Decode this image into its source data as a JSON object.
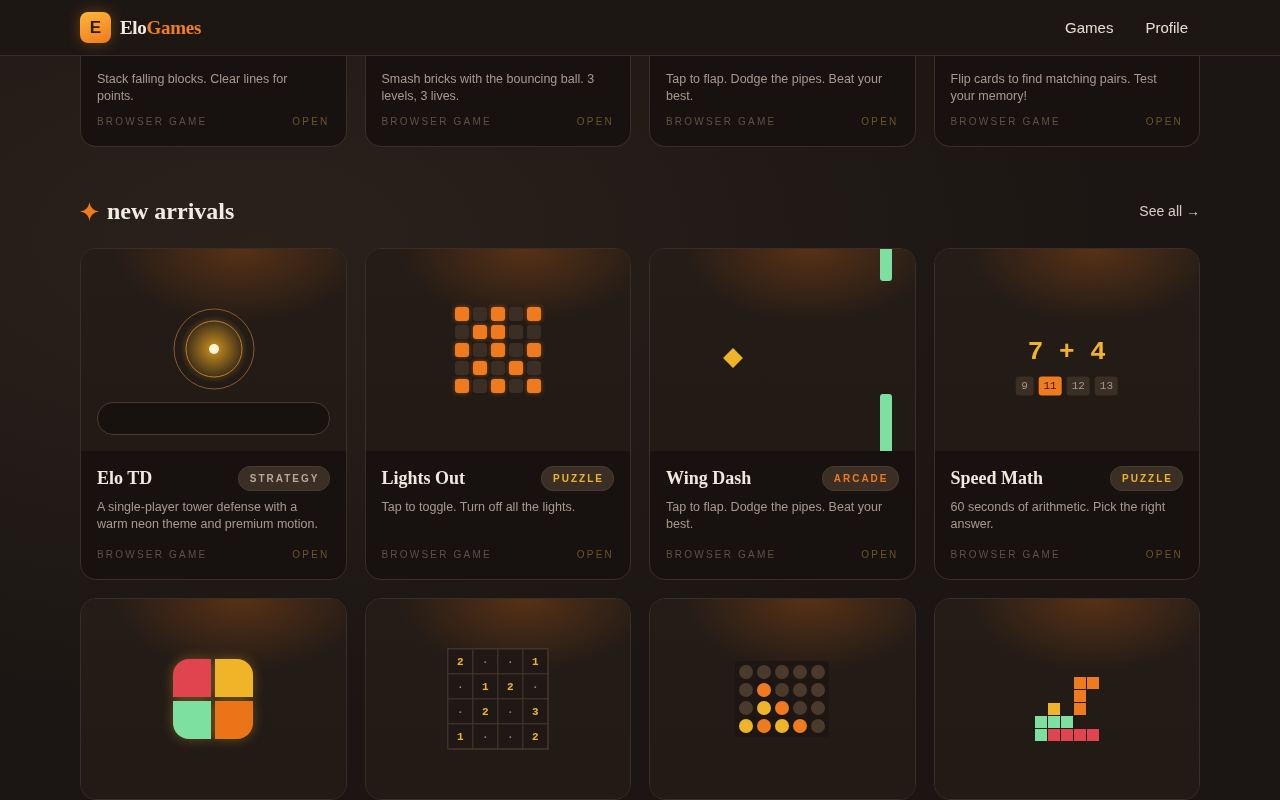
{
  "header": {
    "brand": {
      "mark": "E",
      "first": "Elo",
      "second": "Games"
    },
    "nav": [
      {
        "label": "Games"
      },
      {
        "label": "Profile"
      }
    ]
  },
  "top_row": [
    {
      "description": "Stack falling blocks. Clear lines for points.",
      "platform": "BROWSER GAME",
      "action": "OPEN"
    },
    {
      "description": "Smash bricks with the bouncing ball. 3 levels, 3 lives.",
      "platform": "BROWSER GAME",
      "action": "OPEN"
    },
    {
      "description": "Tap to flap. Dodge the pipes. Beat your best.",
      "platform": "BROWSER GAME",
      "action": "OPEN"
    },
    {
      "description": "Flip cards to find matching pairs. Test your memory!",
      "platform": "BROWSER GAME",
      "action": "OPEN"
    }
  ],
  "section": {
    "title": "new arrivals",
    "link": "See all →"
  },
  "cards": [
    {
      "art": {
        "kind": "target"
      },
      "title": "Elo TD",
      "tag": {
        "label": "STRATEGY",
        "kind": "strategy"
      },
      "description": "A single-player tower defense with a warm neon theme and premium motion.",
      "platform": "BROWSER GAME",
      "action": "OPEN"
    },
    {
      "art": {
        "kind": "lights",
        "rows": [
          [
            true,
            false,
            true,
            false,
            true
          ],
          [
            false,
            true,
            true,
            false,
            false
          ],
          [
            true,
            false,
            true,
            false,
            true
          ],
          [
            false,
            true,
            false,
            true,
            false
          ],
          [
            true,
            false,
            true,
            false,
            true
          ]
        ]
      },
      "title": "Lights Out",
      "tag": {
        "label": "PUZZLE",
        "kind": "puzzle"
      },
      "description": "Tap to toggle. Turn off all the lights.",
      "platform": "BROWSER GAME",
      "action": "OPEN"
    },
    {
      "art": {
        "kind": "flappy"
      },
      "title": "Wing Dash",
      "tag": {
        "label": "ARCADE",
        "kind": "arcade"
      },
      "description": "Tap to flap. Dodge the pipes. Beat your best.",
      "platform": "BROWSER GAME",
      "action": "OPEN"
    },
    {
      "art": {
        "kind": "math",
        "question": "7 + 4",
        "answers": [
          {
            "label": "9",
            "selected": false
          },
          {
            "label": "11",
            "selected": true
          },
          {
            "label": "12",
            "selected": false
          },
          {
            "label": "13",
            "selected": false
          }
        ]
      },
      "title": "Speed Math",
      "tag": {
        "label": "PUZZLE",
        "kind": "puzzle"
      },
      "description": "60 seconds of arithmetic. Pick the right answer.",
      "platform": "BROWSER GAME",
      "action": "OPEN"
    },
    {
      "art": {
        "kind": "quad"
      }
    },
    {
      "art": {
        "kind": "grid",
        "rows": [
          [
            "2",
            "·",
            "·",
            "1"
          ],
          [
            "·",
            "1",
            "2",
            "·"
          ],
          [
            "·",
            "2",
            "·",
            "3"
          ],
          [
            "1",
            "·",
            "·",
            "2"
          ]
        ]
      }
    },
    {
      "art": {
        "kind": "discs",
        "rows": [
          [
            {
              "color": "#4a3a2c"
            },
            {
              "color": "#4a3a2c"
            },
            {
              "color": "#4a3a2c"
            },
            {
              "color": "#4a3a2c"
            },
            {
              "color": "#4a3a2c"
            }
          ],
          [
            {
              "color": "#4a3a2c"
            },
            {
              "color": "#f07a1e"
            },
            {
              "color": "#4a3a2c"
            },
            {
              "color": "#4a3a2c"
            },
            {
              "color": "#4a3a2c"
            }
          ],
          [
            {
              "color": "#4a3a2c"
            },
            {
              "color": "#f0b429"
            },
            {
              "color": "#f07a1e"
            },
            {
              "color": "#4a3a2c"
            },
            {
              "color": "#4a3a2c"
            }
          ],
          [
            {
              "color": "#f0b429"
            },
            {
              "color": "#f07a1e"
            },
            {
              "color": "#f0b429"
            },
            {
              "color": "#f07a1e"
            },
            {
              "color": "#4a3a2c"
            }
          ]
        ]
      }
    },
    {
      "art": {
        "kind": "blocks",
        "rows": [
          [
            null,
            null,
            null,
            {
              "color": "#f07a1e"
            },
            {
              "color": "#f07a1e"
            }
          ],
          [
            null,
            null,
            null,
            {
              "color": "#f07a1e"
            },
            null
          ],
          [
            null,
            {
              "color": "#f0b429"
            },
            null,
            {
              "color": "#f07a1e"
            },
            null
          ],
          [
            {
              "color": "#7ee0a0"
            },
            {
              "color": "#7ee0a0"
            },
            {
              "color": "#7ee0a0"
            },
            null,
            null
          ],
          [
            {
              "color": "#7ee0a0"
            },
            {
              "color": "#e0444f"
            },
            {
              "color": "#e0444f"
            },
            {
              "color": "#e0444f"
            },
            {
              "color": "#e0444f"
            }
          ]
        ]
      }
    }
  ]
}
